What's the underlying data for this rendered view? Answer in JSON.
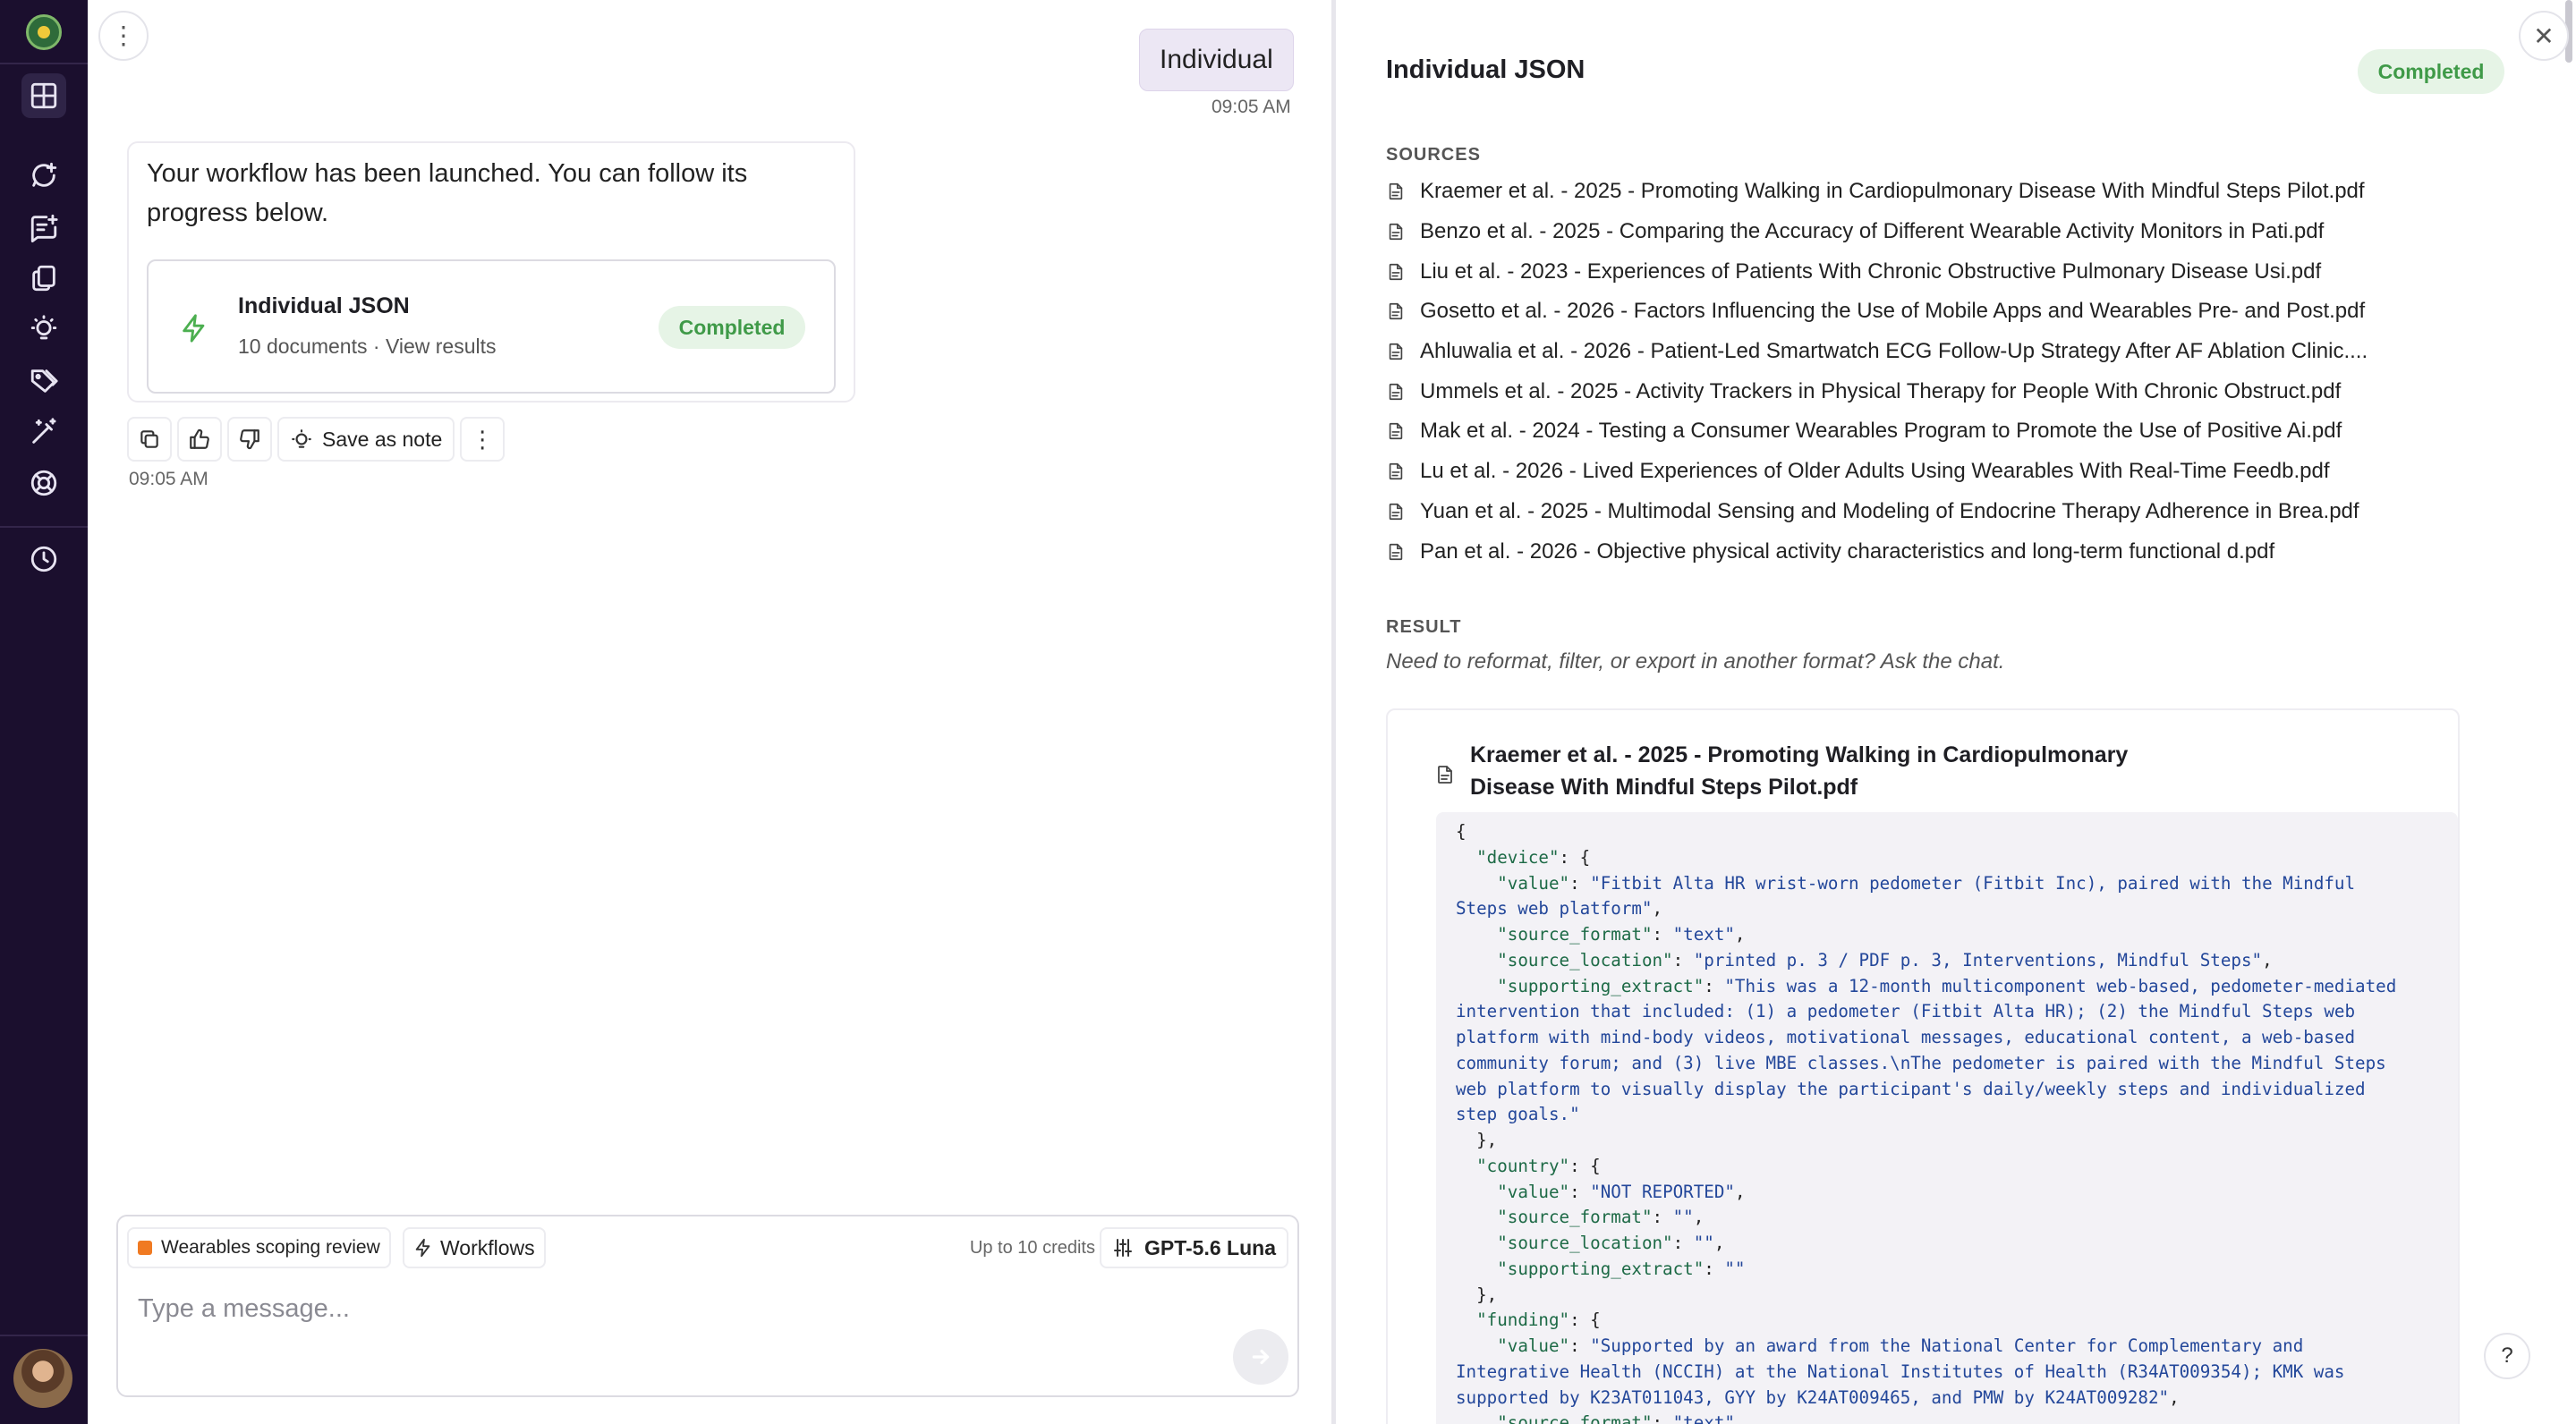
{
  "sidebar": {
    "nav": [
      "dashboard",
      "new-chat",
      "new-note",
      "documents",
      "insights",
      "tags",
      "magic-tools",
      "support",
      "history"
    ]
  },
  "chat": {
    "user_message": "Individual",
    "user_time": "09:05 AM",
    "assistant_text": "Your workflow has been launched. You can follow its progress below.",
    "workflow": {
      "title": "Individual JSON",
      "docs": "10 documents",
      "dot": "·",
      "view_results": "View results",
      "status": "Completed"
    },
    "actions": {
      "save_note": "Save as note"
    },
    "assistant_time": "09:05 AM",
    "composer": {
      "project": "Wearables scoping review",
      "workflows": "Workflows",
      "credits": "Up to 10 credits",
      "model": "GPT-5.6 Luna",
      "placeholder": "Type a message..."
    }
  },
  "panel": {
    "title": "Individual JSON",
    "status": "Completed",
    "sources_label": "SOURCES",
    "sources": [
      "Kraemer et al. - 2025 - Promoting Walking in Cardiopulmonary Disease With Mindful Steps Pilot.pdf",
      "Benzo et al. - 2025 - Comparing the Accuracy of Different Wearable Activity Monitors in Pati.pdf",
      "Liu et al. - 2023 - Experiences of Patients With Chronic Obstructive Pulmonary Disease Usi.pdf",
      "Gosetto et al. - 2026 - Factors Influencing the Use of Mobile Apps and Wearables Pre- and Post.pdf",
      "Ahluwalia et al. - 2026 - Patient-Led Smartwatch ECG Follow-Up Strategy After AF Ablation Clinic....",
      "Ummels et al. - 2025 - Activity Trackers in Physical Therapy for People With Chronic Obstruct.pdf",
      "Mak et al. - 2024 - Testing a Consumer Wearables Program to Promote the Use of Positive Ai.pdf",
      "Lu et al. - 2026 - Lived Experiences of Older Adults Using Wearables With Real-Time Feedb.pdf",
      "Yuan et al. - 2025 - Multimodal Sensing and Modeling of Endocrine Therapy Adherence in Brea.pdf",
      "Pan et al. - 2026 - Objective physical activity characteristics and long-term functional d.pdf"
    ],
    "result_label": "RESULT",
    "result_hint": "Need to reformat, filter, or export in another format? Ask the chat.",
    "result_card": {
      "title": "Kraemer et al. - 2025 - Promoting Walking in Cardiopulmonary Disease With Mindful Steps Pilot.pdf",
      "code_lines": [
        [
          [
            "p",
            "{"
          ]
        ],
        [
          [
            "p",
            "  "
          ],
          [
            "k",
            "\"device\""
          ],
          [
            "p",
            ": {"
          ]
        ],
        [
          [
            "p",
            "    "
          ],
          [
            "k",
            "\"value\""
          ],
          [
            "p",
            ": "
          ],
          [
            "s",
            "\"Fitbit Alta HR wrist-worn pedometer (Fitbit Inc), paired with the Mindful"
          ]
        ],
        [
          [
            "s",
            "Steps web platform\""
          ],
          [
            "p",
            ","
          ]
        ],
        [
          [
            "p",
            "    "
          ],
          [
            "k",
            "\"source_format\""
          ],
          [
            "p",
            ": "
          ],
          [
            "s",
            "\"text\""
          ],
          [
            "p",
            ","
          ]
        ],
        [
          [
            "p",
            "    "
          ],
          [
            "k",
            "\"source_location\""
          ],
          [
            "p",
            ": "
          ],
          [
            "s",
            "\"printed p. 3 / PDF p. 3, Interventions, Mindful Steps\""
          ],
          [
            "p",
            ","
          ]
        ],
        [
          [
            "p",
            "    "
          ],
          [
            "k",
            "\"supporting_extract\""
          ],
          [
            "p",
            ": "
          ],
          [
            "s",
            "\"This was a 12-month multicomponent web-based, pedometer-mediated"
          ]
        ],
        [
          [
            "s",
            "intervention that included: (1) a pedometer (Fitbit Alta HR); (2) the Mindful Steps web"
          ]
        ],
        [
          [
            "s",
            "platform with mind-body videos, motivational messages, educational content, a web-based"
          ]
        ],
        [
          [
            "s",
            "community forum; and (3) live MBE classes.\\nThe pedometer is paired with the Mindful Steps"
          ]
        ],
        [
          [
            "s",
            "web platform to visually display the participant's daily/weekly steps and individualized"
          ]
        ],
        [
          [
            "s",
            "step goals.\""
          ]
        ],
        [
          [
            "p",
            "  },"
          ]
        ],
        [
          [
            "p",
            "  "
          ],
          [
            "k",
            "\"country\""
          ],
          [
            "p",
            ": {"
          ]
        ],
        [
          [
            "p",
            "    "
          ],
          [
            "k",
            "\"value\""
          ],
          [
            "p",
            ": "
          ],
          [
            "s",
            "\"NOT REPORTED\""
          ],
          [
            "p",
            ","
          ]
        ],
        [
          [
            "p",
            "    "
          ],
          [
            "k",
            "\"source_format\""
          ],
          [
            "p",
            ": "
          ],
          [
            "s",
            "\"\""
          ],
          [
            "p",
            ","
          ]
        ],
        [
          [
            "p",
            "    "
          ],
          [
            "k",
            "\"source_location\""
          ],
          [
            "p",
            ": "
          ],
          [
            "s",
            "\"\""
          ],
          [
            "p",
            ","
          ]
        ],
        [
          [
            "p",
            "    "
          ],
          [
            "k",
            "\"supporting_extract\""
          ],
          [
            "p",
            ": "
          ],
          [
            "s",
            "\"\""
          ]
        ],
        [
          [
            "p",
            "  },"
          ]
        ],
        [
          [
            "p",
            "  "
          ],
          [
            "k",
            "\"funding\""
          ],
          [
            "p",
            ": {"
          ]
        ],
        [
          [
            "p",
            "    "
          ],
          [
            "k",
            "\"value\""
          ],
          [
            "p",
            ": "
          ],
          [
            "s",
            "\"Supported by an award from the National Center for Complementary and"
          ]
        ],
        [
          [
            "s",
            "Integrative Health (NCCIH) at the National Institutes of Health (R34AT009354); KMK was"
          ]
        ],
        [
          [
            "s",
            "supported by K23AT011043, GYY by K24AT009465, and PMW by K24AT009282\""
          ],
          [
            "p",
            ","
          ]
        ],
        [
          [
            "p",
            "    "
          ],
          [
            "k",
            "\"source_format\""
          ],
          [
            "p",
            ": "
          ],
          [
            "s",
            "\"text\""
          ],
          [
            "p",
            ","
          ]
        ]
      ]
    },
    "help": "?"
  },
  "colors": {
    "sidebar_bg": "#1b0f2e",
    "completed_bg": "#e6f4e6",
    "completed_text": "#3f9a48",
    "user_bubble": "#ece7f4",
    "bolt": "#4caf50",
    "project_dot": "#f07a22"
  }
}
